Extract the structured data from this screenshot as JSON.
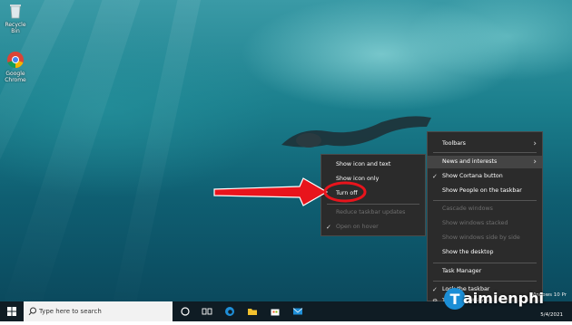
{
  "desktop_icons": [
    {
      "label": "Recycle Bin",
      "icon": "recycle-bin-icon"
    },
    {
      "label": "Google Chrome",
      "icon": "chrome-icon"
    }
  ],
  "taskbar_menu": {
    "items": [
      {
        "label": "Toolbars",
        "submenu": true
      },
      {
        "label": "News and interests",
        "submenu": true,
        "highlighted": true
      },
      {
        "label": "Show Cortana button",
        "checked": true
      },
      {
        "label": "Show People on the taskbar"
      },
      {
        "label": "Cascade windows",
        "disabled": true
      },
      {
        "label": "Show windows stacked",
        "disabled": true
      },
      {
        "label": "Show windows side by side",
        "disabled": true
      },
      {
        "label": "Show the desktop"
      },
      {
        "label": "Task Manager"
      },
      {
        "label": "Lock the taskbar",
        "checked": true
      },
      {
        "label": "Taskbar settings"
      }
    ]
  },
  "news_submenu": {
    "items": [
      {
        "label": "Show icon and text"
      },
      {
        "label": "Show icon only"
      },
      {
        "label": "Turn off",
        "annotated": true
      },
      {
        "label": "Reduce taskbar updates",
        "disabled": true
      },
      {
        "label": "Open on hover",
        "disabled": true,
        "checked": true
      }
    ]
  },
  "taskbar": {
    "search_placeholder": "Type here to search",
    "date": "5/4/2021",
    "icons": [
      "cortana-icon",
      "task-view-icon",
      "edge-icon",
      "file-explorer-icon",
      "store-icon",
      "mail-icon"
    ]
  },
  "watermark": {
    "text": "Windows 10 Pr",
    "logo": "aimienphi"
  },
  "colors": {
    "annotation": "#e8141c",
    "menu_bg": "#2b2b2b",
    "taskbar": "#0f1c24"
  }
}
